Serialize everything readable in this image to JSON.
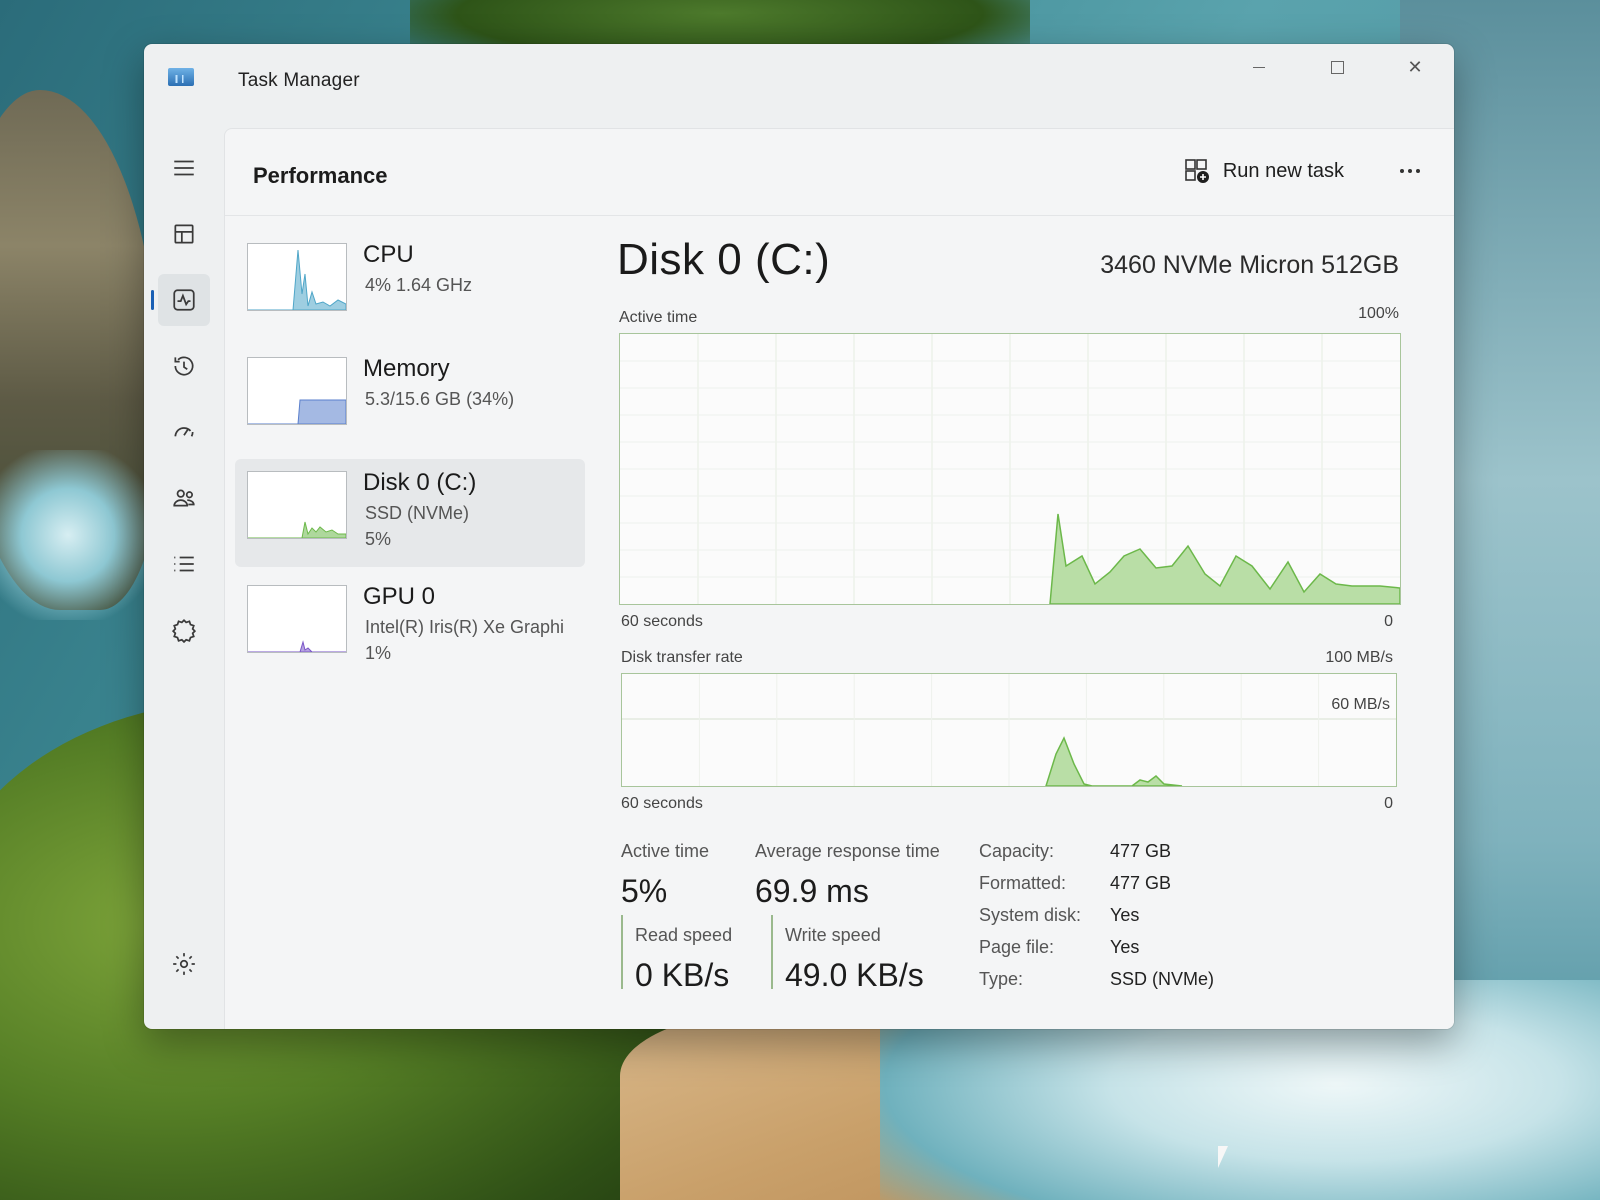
{
  "window": {
    "title": "Task Manager"
  },
  "header": {
    "page_title": "Performance",
    "run_new_task_label": "Run new task",
    "more_icon": "more-horizontal-icon"
  },
  "nav": [
    {
      "name": "hamburger-menu",
      "icon": "hamburger-icon",
      "active": false
    },
    {
      "name": "processes",
      "icon": "processes-icon",
      "active": false
    },
    {
      "name": "performance",
      "icon": "performance-icon",
      "active": true
    },
    {
      "name": "app-history",
      "icon": "history-icon",
      "active": false
    },
    {
      "name": "startup-apps",
      "icon": "startup-icon",
      "active": false
    },
    {
      "name": "users",
      "icon": "users-icon",
      "active": false
    },
    {
      "name": "details",
      "icon": "details-icon",
      "active": false
    },
    {
      "name": "services",
      "icon": "services-icon",
      "active": false
    },
    {
      "name": "settings",
      "icon": "gear-icon",
      "active": false
    }
  ],
  "perf_items": [
    {
      "name": "CPU",
      "line1": "4%  1.64 GHz",
      "line2": "",
      "selected": false,
      "color": "#4fa6c8"
    },
    {
      "name": "Memory",
      "line1": "5.3/15.6 GB (34%)",
      "line2": "",
      "selected": false,
      "color": "#5a7fcc"
    },
    {
      "name": "Disk 0 (C:)",
      "line1": "SSD (NVMe)",
      "line2": "5%",
      "selected": true,
      "color": "#6cb84a"
    },
    {
      "name": "GPU 0",
      "line1": "Intel(R) Iris(R) Xe Graphi",
      "line2": "1%",
      "selected": false,
      "color": "#7a56c8"
    }
  ],
  "detail": {
    "title": "Disk 0 (C:)",
    "model": "3460 NVMe Micron 512GB",
    "active_time_graph": {
      "label": "Active time",
      "max_label": "100%",
      "x_left_label": "60 seconds",
      "x_right_label": "0"
    },
    "transfer_graph": {
      "label": "Disk transfer rate",
      "max_label": "100 MB/s",
      "mid_label": "60 MB/s",
      "x_left_label": "60 seconds",
      "x_right_label": "0"
    },
    "stats": {
      "active_time_label": "Active time",
      "active_time_value": "5%",
      "avg_response_label": "Average response time",
      "avg_response_value": "69.9 ms",
      "read_speed_label": "Read speed",
      "read_speed_value": "0 KB/s",
      "write_speed_label": "Write speed",
      "write_speed_value": "49.0 KB/s"
    },
    "properties": [
      {
        "key": "Capacity:",
        "value": "477 GB"
      },
      {
        "key": "Formatted:",
        "value": "477 GB"
      },
      {
        "key": "System disk:",
        "value": "Yes"
      },
      {
        "key": "Page file:",
        "value": "Yes"
      },
      {
        "key": "Type:",
        "value": "SSD (NVMe)"
      }
    ]
  },
  "colors": {
    "disk_line": "#6cb84a",
    "disk_fill": "#b9dea6",
    "accent": "#1a5fb4"
  }
}
